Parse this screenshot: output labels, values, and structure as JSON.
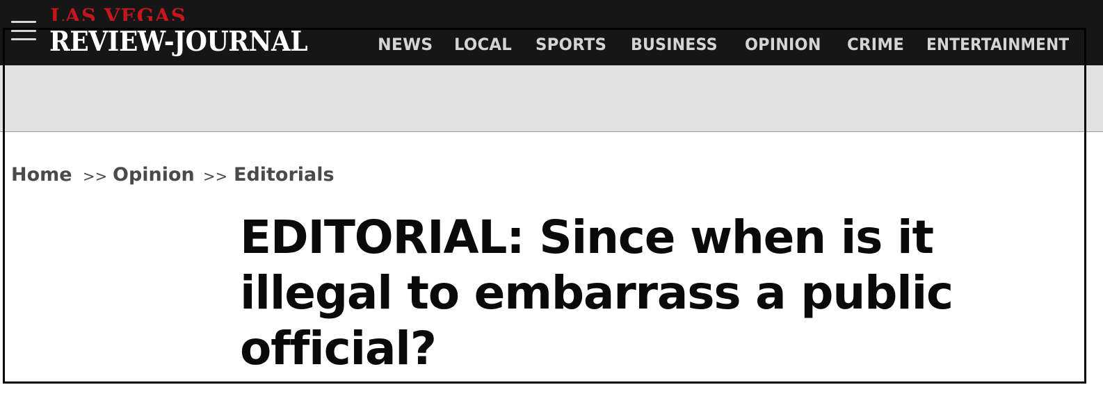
{
  "header": {
    "logo_top": "LAS VEGAS",
    "logo_main": "REVIEW-JOURNAL",
    "menu_icon": "hamburger-menu-icon",
    "nav": [
      "NEWS",
      "LOCAL",
      "SPORTS",
      "BUSINESS",
      "OPINION",
      "CRIME",
      "ENTERTAINMENT"
    ]
  },
  "breadcrumb": {
    "items": [
      "Home",
      "Opinion",
      "Editorials"
    ],
    "separator": ">>"
  },
  "article": {
    "headline": "EDITORIAL: Since when is it illegal to embarrass a public official?"
  },
  "colors": {
    "topbar": "#161616",
    "logo_red": "#c4161c",
    "nav_text": "#d4d4d4",
    "ad_band": "#e2e2e2"
  }
}
